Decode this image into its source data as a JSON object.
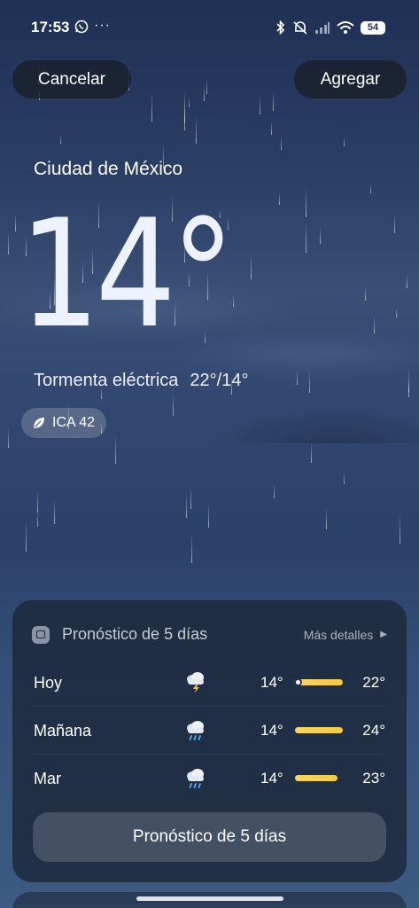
{
  "status": {
    "time": "17:53",
    "more": "···",
    "battery": "54"
  },
  "header": {
    "cancel": "Cancelar",
    "add": "Agregar"
  },
  "weather": {
    "city": "Ciudad de México",
    "temp": "14°",
    "condition": "Tormenta eléctrica",
    "range": "22°/14°",
    "aqi": "ICA 42"
  },
  "forecast": {
    "title": "Pronóstico de 5 días",
    "more": "Más detalles",
    "button": "Pronóstico de 5 días",
    "days": [
      {
        "day": "Hoy",
        "icon": "thunderstorm-icon",
        "low": "14°",
        "high": "22°"
      },
      {
        "day": "Mañana",
        "icon": "rain-cloud-icon",
        "low": "14°",
        "high": "24°"
      },
      {
        "day": "Mar",
        "icon": "rain-cloud-icon",
        "low": "14°",
        "high": "23°"
      }
    ]
  },
  "colors": {
    "accent_bar": "#f4d66a",
    "card_bg": "#1e2a3e"
  }
}
